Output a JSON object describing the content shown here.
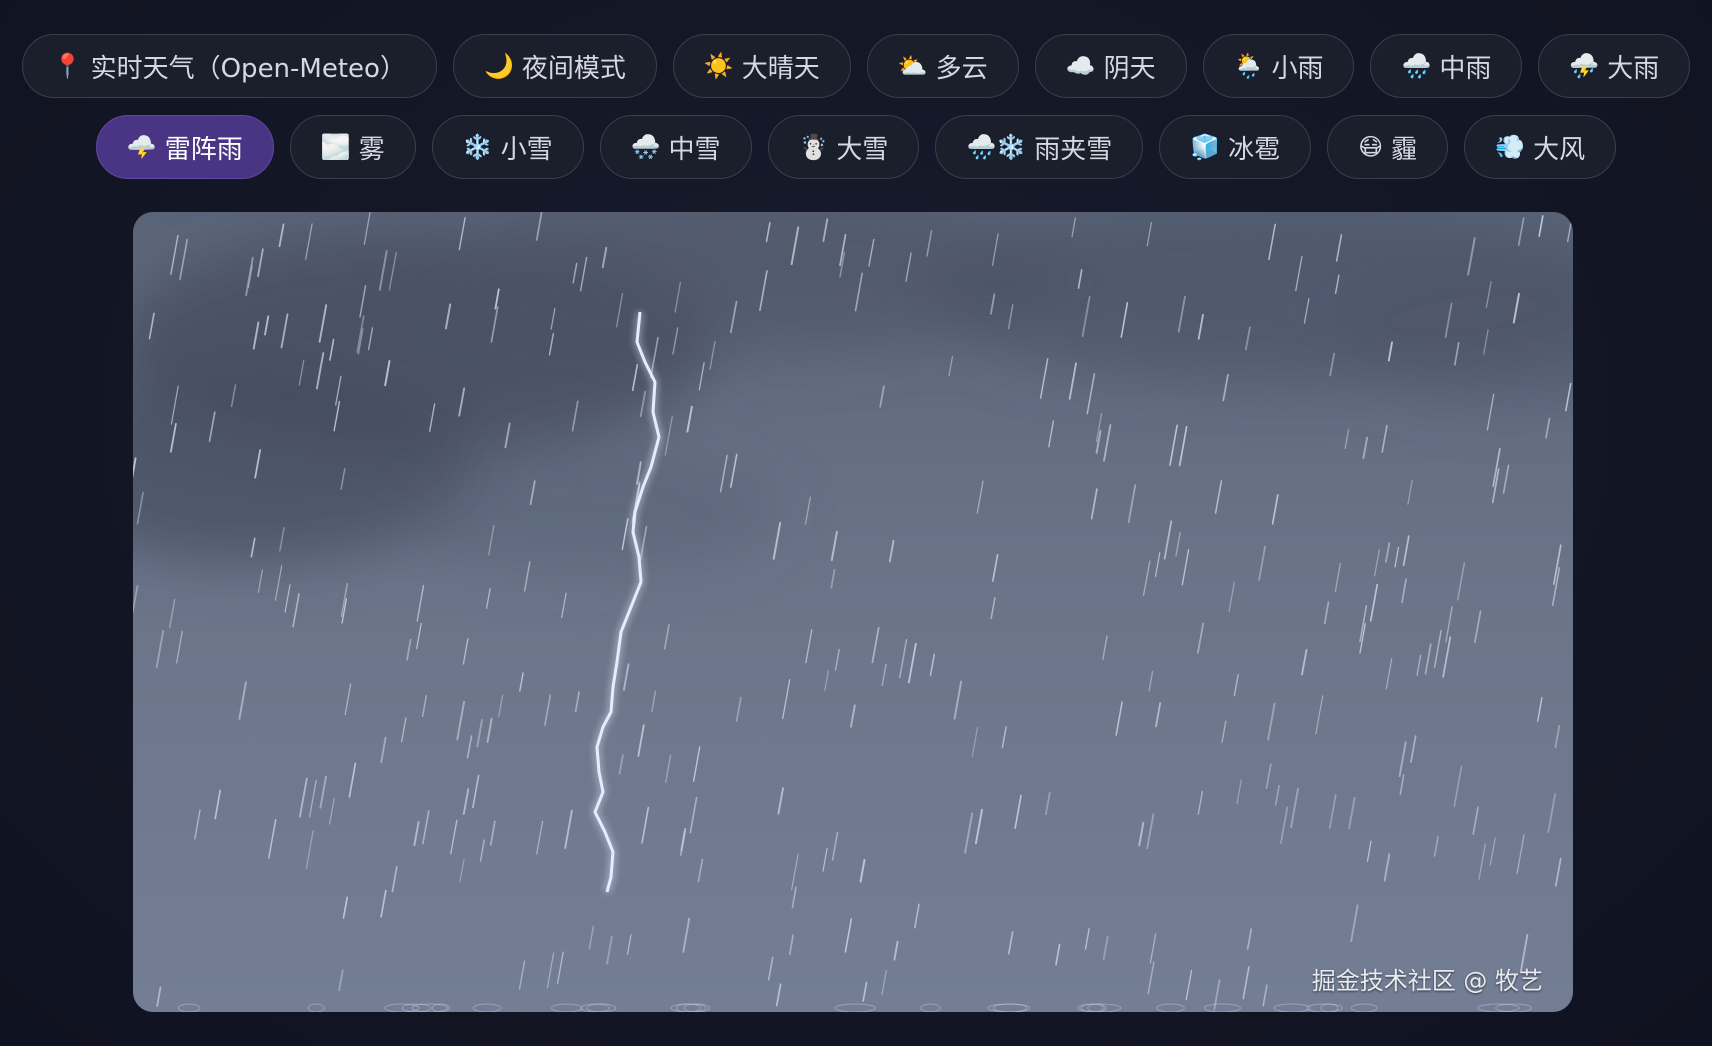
{
  "toolbar": {
    "row1": [
      {
        "id": "realtime",
        "icon": "📍",
        "icon_name": "pin-icon",
        "label": "实时天气（Open-Meteo）"
      },
      {
        "id": "night",
        "icon": "🌙",
        "icon_name": "moon-icon",
        "label": "夜间模式"
      },
      {
        "id": "sunny",
        "icon": "☀️",
        "icon_name": "sun-icon",
        "label": "大晴天"
      },
      {
        "id": "cloudy",
        "icon": "⛅",
        "icon_name": "partly-cloudy-icon",
        "label": "多云"
      },
      {
        "id": "overcast",
        "icon": "☁️",
        "icon_name": "cloud-icon",
        "label": "阴天"
      },
      {
        "id": "light-rain",
        "icon": "🌦️",
        "icon_name": "sun-rain-icon",
        "label": "小雨"
      },
      {
        "id": "moderate-rain",
        "icon": "🌧️",
        "icon_name": "rain-cloud-icon",
        "label": "中雨"
      },
      {
        "id": "heavy-rain",
        "icon": "⛈️",
        "icon_name": "storm-cloud-icon",
        "label": "大雨"
      }
    ],
    "row2": [
      {
        "id": "thunderstorm",
        "icon": "🌩️",
        "icon_name": "lightning-cloud-icon",
        "label": "雷阵雨",
        "active": true
      },
      {
        "id": "fog",
        "icon": "🌫️",
        "icon_name": "fog-icon",
        "label": "雾"
      },
      {
        "id": "light-snow",
        "icon": "❄️",
        "icon_name": "snowflake-icon",
        "label": "小雪"
      },
      {
        "id": "moderate-snow",
        "icon": "🌨️",
        "icon_name": "snow-cloud-icon",
        "label": "中雪"
      },
      {
        "id": "heavy-snow",
        "icon": "☃️",
        "icon_name": "snowman-icon",
        "label": "大雪"
      },
      {
        "id": "sleet",
        "icon": "🌧️❄️",
        "icon_name": "sleet-icon",
        "label": "雨夹雪"
      },
      {
        "id": "hail",
        "icon": "🧊",
        "icon_name": "ice-cube-icon",
        "label": "冰雹"
      },
      {
        "id": "haze",
        "icon": "😷",
        "icon_name": "mask-face-icon",
        "label": "霾"
      },
      {
        "id": "wind",
        "icon": "💨",
        "icon_name": "wind-icon",
        "label": "大风"
      }
    ]
  },
  "scene": {
    "weather": "thunderstorm",
    "colors": {
      "sky_top": "#5b6579",
      "sky_bottom": "#737e95",
      "cloud": "#444b5e",
      "rain": "#c8cfdd",
      "lightning": "#e6ecff"
    }
  },
  "watermark": "掘金技术社区 @ 牧艺"
}
